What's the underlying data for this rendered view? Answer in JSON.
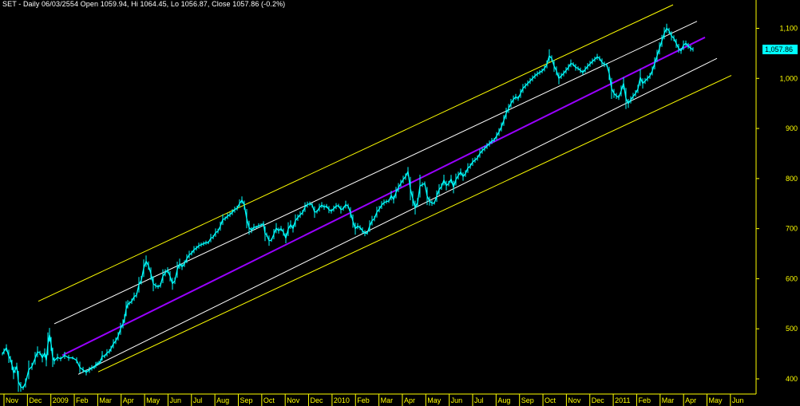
{
  "title": "SET - Daily 06/03/2554 Open 1059.94, Hi 1064.45, Lo 1056.87, Close 1057.86 (-0.2%)",
  "last_price_label": "1,057.86",
  "colors": {
    "background": "#000000",
    "axis": "#ffff00",
    "price": "#00ffff",
    "regression": "#9900ff",
    "inner_band": "#ffffff",
    "outer_band": "#ffff00"
  },
  "chart_data": {
    "type": "line",
    "title": "SET - Daily 06/03/2554 Open 1059.94, Hi 1064.45, Lo 1056.87, Close 1057.86 (-0.2%)",
    "ylabel": "",
    "xlabel": "",
    "ylim": [
      360,
      1160
    ],
    "grid": false,
    "y_ticks": [
      {
        "value": 1100,
        "label": "1,100"
      },
      {
        "value": 1000,
        "label": "1,000"
      },
      {
        "value": 900,
        "label": "900"
      },
      {
        "value": 800,
        "label": "800"
      },
      {
        "value": 700,
        "label": "700"
      },
      {
        "value": 600,
        "label": "600"
      },
      {
        "value": 500,
        "label": "500"
      },
      {
        "value": 400,
        "label": "400"
      }
    ],
    "x_ticks": [
      "Nov",
      "Dec",
      "2009",
      "Feb",
      "Mar",
      "Apr",
      "May",
      "Jun",
      "Jul",
      "Aug",
      "Sep",
      "Oct",
      "Nov",
      "Dec",
      "2010",
      "Feb",
      "Mar",
      "Apr",
      "May",
      "Jun",
      "Jul",
      "Aug",
      "Sep",
      "Oct",
      "Nov",
      "Dec",
      "2011",
      "Feb",
      "Mar",
      "Apr",
      "May",
      "Jun"
    ],
    "series": [
      {
        "kind": "price",
        "x": [
          0,
          2,
          5,
          8,
          10,
          12,
          14,
          16,
          18,
          20,
          23,
          26,
          29,
          33,
          37,
          41,
          44,
          47,
          50,
          53,
          55,
          57,
          59,
          61,
          63,
          65,
          69,
          73,
          78,
          83,
          88,
          93,
          97,
          101,
          105,
          109,
          112,
          115,
          117,
          119,
          121,
          123,
          125,
          128,
          131,
          134,
          136,
          139,
          142,
          145,
          148,
          151,
          153,
          155,
          157,
          159,
          162,
          165,
          168,
          171,
          174,
          177,
          180,
          183,
          186,
          189,
          192,
          195,
          198,
          201,
          204,
          207,
          210,
          213,
          216,
          219,
          222,
          225,
          228,
          231,
          234,
          237,
          240,
          243,
          246,
          249,
          252,
          255,
          258,
          261,
          264,
          267,
          270,
          273,
          276,
          279,
          282,
          285,
          288,
          291,
          294,
          297,
          300,
          303,
          306,
          309,
          312,
          315,
          318,
          321,
          324,
          327,
          329,
          331,
          334,
          337,
          340,
          343,
          346,
          349,
          352,
          355,
          358,
          361,
          364,
          367,
          370,
          373,
          376,
          379,
          382,
          385,
          388,
          391,
          394,
          397,
          400,
          403,
          406,
          409,
          412,
          415,
          418,
          421,
          424,
          427,
          430,
          433,
          436,
          439,
          442,
          445,
          448,
          451,
          454,
          457,
          460,
          463,
          466,
          469,
          472,
          475,
          478,
          481,
          484,
          487,
          490,
          493,
          496,
          499,
          502,
          505,
          508,
          511,
          514,
          517,
          520,
          523,
          526,
          529,
          532,
          535,
          538,
          541,
          544,
          547,
          550,
          553,
          556,
          559,
          562,
          565,
          568,
          571,
          574,
          577,
          580,
          583,
          586,
          589,
          592,
          595,
          598,
          601,
          604,
          607,
          610,
          613,
          616,
          619,
          622,
          625,
          628,
          631,
          634,
          637,
          640,
          643,
          646,
          649,
          652,
          655,
          658,
          661,
          664,
          667,
          670,
          673,
          676,
          679,
          682,
          685,
          688,
          691,
          694,
          697,
          700,
          703,
          706,
          709,
          712,
          715,
          718,
          721,
          724,
          727,
          730,
          733,
          736,
          739,
          742,
          745,
          748,
          751,
          754,
          757,
          760,
          763,
          766,
          769,
          772,
          775,
          778,
          781,
          784,
          787,
          790,
          793,
          796,
          799,
          802,
          805,
          808,
          811,
          814,
          817,
          820,
          823,
          826,
          829,
          832,
          835,
          838,
          841,
          844,
          847,
          850,
          853,
          856,
          859,
          862,
          865,
          868,
          871,
          874,
          877,
          880
        ],
        "close": [
          450,
          455,
          462,
          445,
          440,
          428,
          412,
          418,
          425,
          395,
          384,
          382,
          392,
          418,
          425,
          441,
          454,
          452,
          442,
          452,
          437,
          470,
          488,
          470,
          443,
          436,
          443,
          440,
          447,
          442,
          442,
          437,
          423,
          418,
          413,
          418,
          422,
          423,
          428,
          430,
          432,
          435,
          446,
          445,
          452,
          455,
          460,
          470,
          476,
          485,
          500,
          510,
          520,
          540,
          549,
          551,
          555,
          564,
          567,
          588,
          597,
          621,
          635,
          626,
          610,
          590,
          586,
          584,
          587,
          605,
          612,
          617,
          605,
          590,
          596,
          618,
          630,
          624,
          630,
          640,
          648,
          651,
          658,
          661,
          666,
          668,
          670,
          672,
          672,
          681,
          683,
          692,
          695,
          705,
          718,
          720,
          725,
          728,
          733,
          738,
          741,
          750,
          757,
          747,
          720,
          702,
          697,
          703,
          703,
          706,
          707,
          710,
          690,
          688,
          676,
          677,
          689,
          701,
          696,
          700,
          693,
          681,
          699,
          708,
          700,
          716,
          722,
          728,
          732,
          743,
          748,
          750,
          747,
          733,
          734,
          742,
          747,
          743,
          745,
          738,
          735,
          740,
          745,
          746,
          738,
          740,
          748,
          745,
          732,
          715,
          700,
          705,
          702,
          696,
          691,
          691,
          705,
          716,
          720,
          733,
          739,
          747,
          752,
          754,
          755,
          766,
          758,
          772,
          782,
          790,
          798,
          804,
          814,
          780,
          760,
          742,
          752,
          785,
          788,
          790,
          765,
          755,
          751,
          751,
          765,
          778,
          784,
          797,
          786,
          790,
          799,
          783,
          798,
          806,
          813,
          804,
          810,
          821,
          825,
          833,
          837,
          841,
          850,
          856,
          860,
          865,
          870,
          875,
          877,
          885,
          893,
          903,
          916,
          930,
          940,
          950,
          958,
          963,
          960,
          970,
          980,
          985,
          990,
          995,
          1000,
          1005,
          1009,
          1012,
          1015,
          1020,
          1028,
          1045,
          1040,
          1025,
          1015,
          1000,
          1005,
          1010,
          1016,
          1022,
          1030,
          1028,
          1022,
          1020,
          1016,
          1012,
          1018,
          1024,
          1029,
          1034,
          1038,
          1043,
          1040,
          1032,
          1028,
          1027,
          1010,
          980,
          970,
          965,
          962,
          975,
          990,
          960,
          950,
          957,
          964,
          970,
          979,
          1002,
          990,
          995,
          1000,
          1005,
          1015,
          1030,
          1045,
          1060,
          1075,
          1090,
          1100,
          1095,
          1085,
          1080,
          1070,
          1060,
          1055,
          1066,
          1070,
          1065,
          1060,
          1057.86
        ]
      },
      {
        "kind": "regression",
        "x": [
          75,
          880
        ],
        "y": [
          447,
          1082
        ]
      },
      {
        "kind": "inner_band_upper",
        "x": [
          65,
          870
        ],
        "y": [
          510,
          1114
        ]
      },
      {
        "kind": "inner_band_lower",
        "x": [
          95,
          895
        ],
        "y": [
          409,
          1040
        ]
      },
      {
        "kind": "outer_band_upper",
        "x": [
          45,
          840
        ],
        "y": [
          555,
          1147
        ]
      },
      {
        "kind": "outer_band_lower",
        "x": [
          120,
          913
        ],
        "y": [
          414,
          1006
        ]
      }
    ]
  }
}
